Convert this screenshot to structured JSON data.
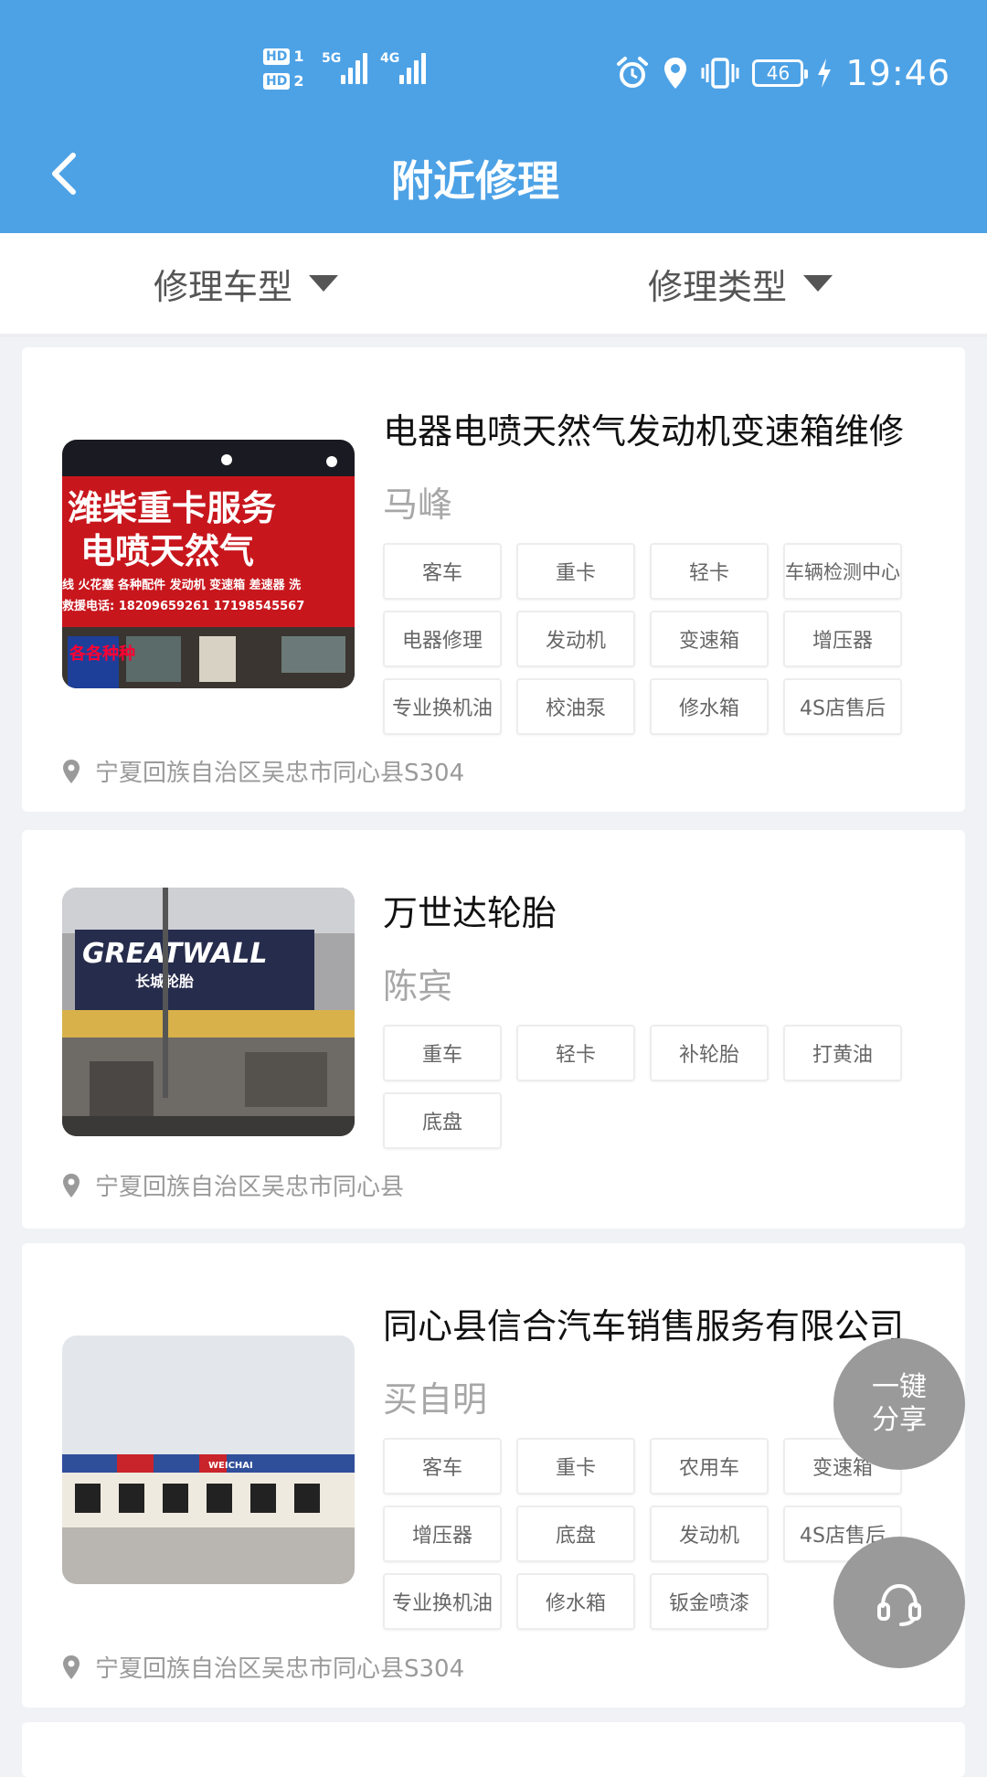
{
  "status_bar": {
    "sim1": "HD",
    "sim1_num": "1",
    "sim2": "HD",
    "sim2_num": "2",
    "net1": "5G",
    "net2": "4G",
    "battery": "46",
    "time": "19:46"
  },
  "nav": {
    "title": "附近修理"
  },
  "filters": {
    "vehicle_type": "修理车型",
    "repair_type": "修理类型"
  },
  "shops": [
    {
      "name": "电器电喷天然气发动机变速箱维修",
      "person": "马峰",
      "tags": [
        "客车",
        "重卡",
        "轻卡",
        "车辆检测中心",
        "电器修理",
        "发动机",
        "变速箱",
        "增压器",
        "专业换机油",
        "校油泵",
        "修水箱",
        "4S店售后"
      ],
      "address": "宁夏回族自治区吴忠市同心县S304",
      "photo_sign_line1": "潍柴重卡服务",
      "photo_sign_line2": "电喷天然气",
      "photo_sign_line3": "线 火花塞 各种配件 发动机 变速箱 差速器 洗",
      "photo_sign_line4": "救援电话: 18209659261  17198545567",
      "photo_side_sign": "各各种种"
    },
    {
      "name": "万世达轮胎",
      "person": "陈宾",
      "tags": [
        "重车",
        "轻卡",
        "补轮胎",
        "打黄油",
        "底盘"
      ],
      "address": "宁夏回族自治区吴忠市同心县",
      "photo_sign_line1": "GREATWALL",
      "photo_sign_line2": "长城轮胎"
    },
    {
      "name": "同心县信合汽车销售服务有限公司",
      "person": "买自明",
      "tags": [
        "客车",
        "重卡",
        "农用车",
        "变速箱",
        "增压器",
        "底盘",
        "发动机",
        "4S店售后",
        "专业换机油",
        "修水箱",
        "钣金喷漆"
      ],
      "address": "宁夏回族自治区吴忠市同心县S304",
      "photo_sign_line1": "WEICHAI"
    }
  ],
  "fab": {
    "share_line1": "一键",
    "share_line2": "分享"
  },
  "colors": {
    "header": "#4da2e6",
    "tag_border": "#ededed",
    "muted_text": "#a7a7a7",
    "fab": "#9a9a9a"
  }
}
